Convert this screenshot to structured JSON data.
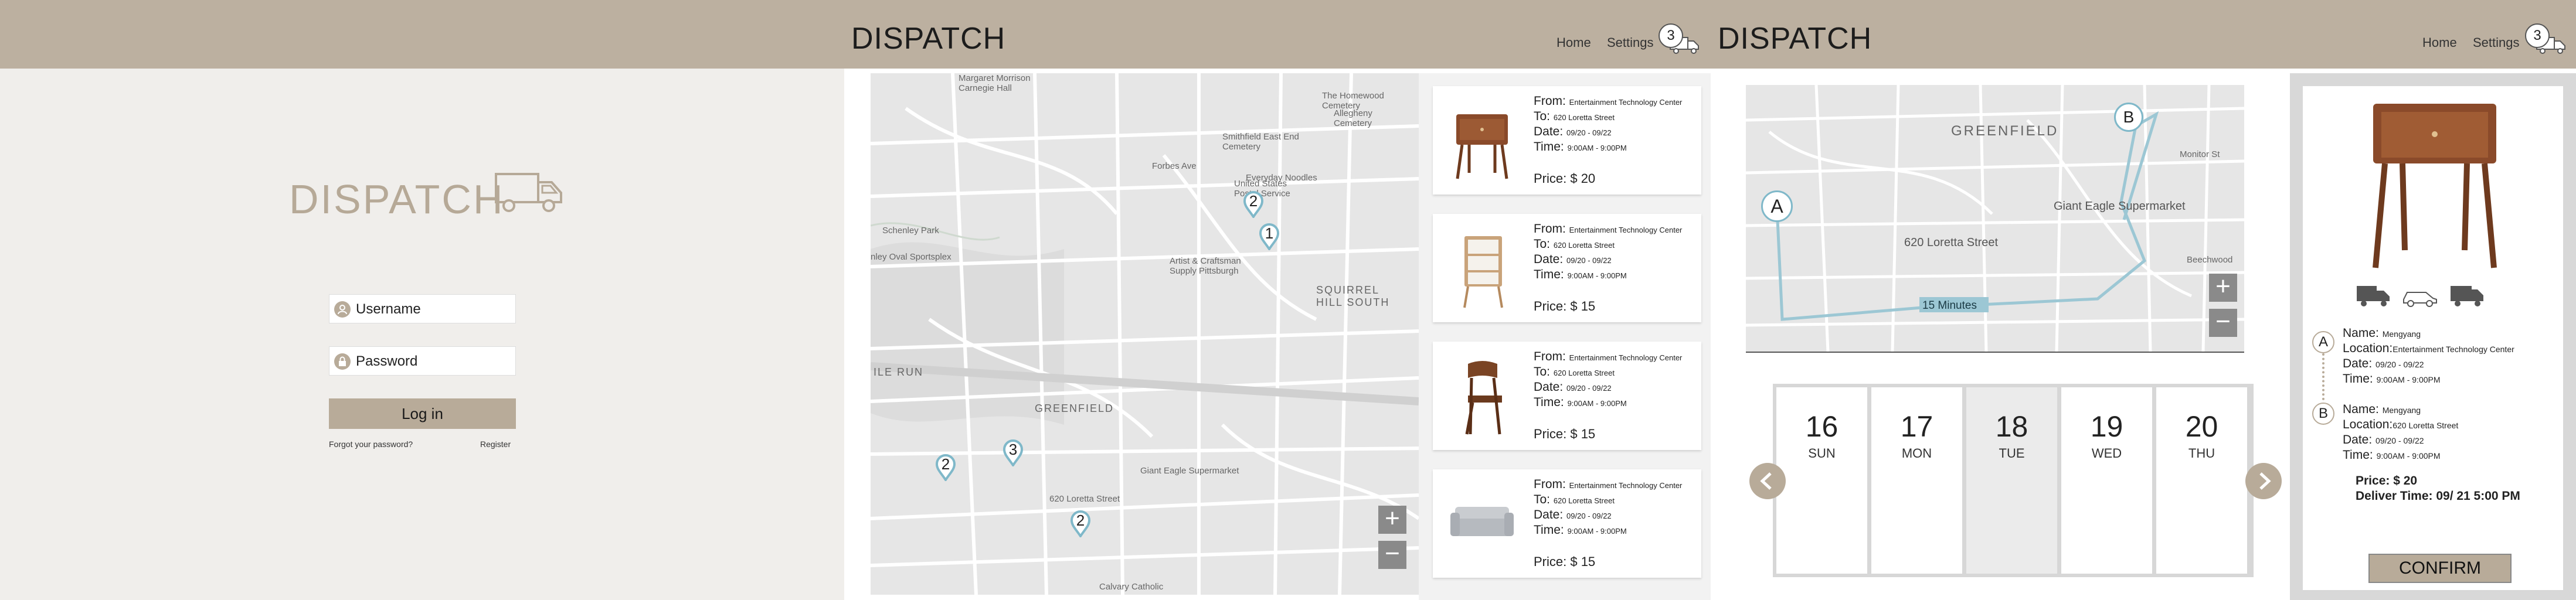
{
  "login": {
    "brand": "DISPATCH",
    "username_label": "Username",
    "password_label": "Password",
    "login_button": "Log in",
    "forgot_link": "Forgot your password?",
    "register_link": "Register"
  },
  "header": {
    "brand": "DISPATCH",
    "nav_home": "Home",
    "nav_settings": "Settings",
    "badge_count": "3"
  },
  "map1": {
    "labels": {
      "carnegie": "Margaret Morrison\nCarnegie Hall",
      "homewood": "The Homewood\nCemetery",
      "allegheny": "Allegheny\nCemetery",
      "smithfield": "Smithfield East End\nCemetery",
      "forbes": "Forbes Ave",
      "everyday": "Everyday Noodles",
      "usps": "United States\nPostal Service",
      "schenley": "Schenley Park",
      "oval": "nley Oval Sportsplex",
      "artist": "Artist & Craftsman\nSupply Pittsburgh",
      "squirrel": "SQUIRREL\nHILL SOUTH",
      "irun": "ILE RUN",
      "greenfield": "GREENFIELD",
      "giant": "Giant Eagle Supermarket",
      "loretta": "620 Loretta Street",
      "calvary": "Calvary Catholic"
    },
    "pins": [
      "2",
      "1",
      "3",
      "2",
      "2"
    ]
  },
  "orders": [
    {
      "from_label": "From:",
      "from": "Entertainment Technology Center",
      "to_label": "To:",
      "to": "620 Loretta Street",
      "date_label": "Date:",
      "date": "09/20 - 09/22",
      "time_label": "Time:",
      "time": "9:00AM - 9:00PM",
      "price": "Price: $ 20"
    },
    {
      "from_label": "From:",
      "from": "Entertainment Technology Center",
      "to_label": "To:",
      "to": "620 Loretta Street",
      "date_label": "Date:",
      "date": "09/20 - 09/22",
      "time_label": "Time:",
      "time": "9:00AM - 9:00PM",
      "price": "Price: $ 15"
    },
    {
      "from_label": "From:",
      "from": "Entertainment Technology Center",
      "to_label": "To:",
      "to": "620 Loretta Street",
      "date_label": "Date:",
      "date": "09/20 - 09/22",
      "time_label": "Time:",
      "time": "9:00AM - 9:00PM",
      "price": "Price: $ 15"
    },
    {
      "from_label": "From:",
      "from": "Entertainment Technology Center",
      "to_label": "To:",
      "to": "620 Loretta Street",
      "date_label": "Date:",
      "date": "09/20 - 09/22",
      "time_label": "Time:",
      "time": "9:00AM - 9:00PM",
      "price": "Price: $ 15"
    }
  ],
  "route_map": {
    "greenfield": "GREENFIELD",
    "giant": "Giant Eagle Supermarket",
    "loretta": "620 Loretta Street",
    "duration": "15 Minutes",
    "pin_a": "A",
    "pin_b": "B",
    "monitor": "Monitor St",
    "beechwood": "Beechwood"
  },
  "calendar": [
    {
      "num": "16",
      "name": "SUN"
    },
    {
      "num": "17",
      "name": "MON"
    },
    {
      "num": "18",
      "name": "TUE"
    },
    {
      "num": "19",
      "name": "WED"
    },
    {
      "num": "20",
      "name": "THU"
    }
  ],
  "detail": {
    "a_marker": "A",
    "b_marker": "B",
    "a_name_label": "Name:",
    "a_name": "Mengyang",
    "a_location_label": "Location:",
    "a_location": "Entertainment Technology Center",
    "a_date_label": "Date:",
    "a_date": "09/20 - 09/22",
    "a_time_label": "Time:",
    "a_time": "9:00AM - 9:00PM",
    "b_name_label": "Name:",
    "b_name": "Mengyang",
    "b_location_label": "Location:",
    "b_location": "620 Loretta Street",
    "b_date_label": "Date:",
    "b_date": "09/20 - 09/22",
    "b_time_label": "Time:",
    "b_time": "9:00AM - 9:00PM",
    "price": "Price: $ 20",
    "deliver_time": "Deliver Time: 09/ 21 5:00 PM",
    "confirm": "CONFIRM"
  },
  "colors": {
    "header": "#bcb0a0",
    "accent": "#b8ab99",
    "route": "#9cc7d4",
    "pin": "#7fb8c9"
  }
}
